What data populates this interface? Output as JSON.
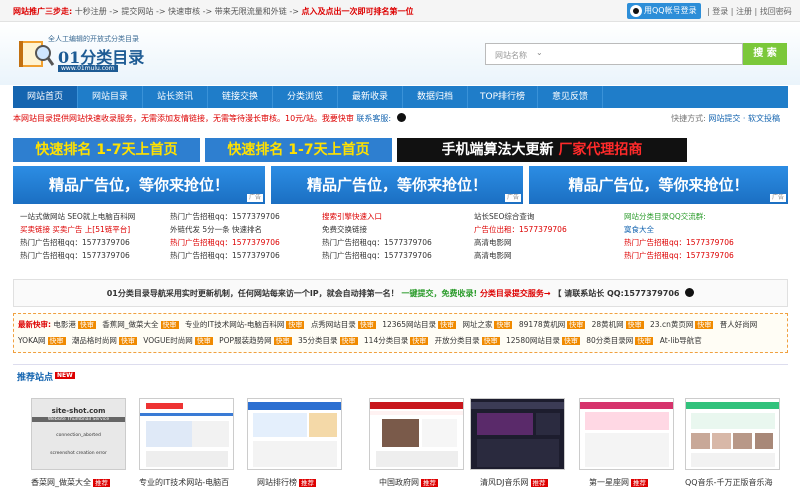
{
  "topbar": {
    "lead": "网站推广三步走:",
    "steps": "十秒注册 -> 提交网站 -> 快速审核 -> 带来无限流量和外链 ->",
    "highlight": "点入及点出一次即可排名第一位",
    "qq_login": "用QQ帐号登录",
    "links": "| 登录 | 注册 | 找回密码"
  },
  "header": {
    "logo_tagline": "全人工编辑的开放式分类目录",
    "logo_name": "01分类目录",
    "logo_url": "www.01mulu.com",
    "search_placeholder": "网站名称",
    "search_button": "搜 索"
  },
  "nav": [
    "网站首页",
    "网站目录",
    "站长资讯",
    "链接交换",
    "分类浏览",
    "最新收录",
    "数据归档",
    "TOP排行榜",
    "意见反馈"
  ],
  "notice": {
    "text": "本网站目录提供网站快速收录服务，无需添加友情链接，无需等待漫长审核。10元/站。我要快审",
    "contact": "联系客服:",
    "right_label": "快捷方式:",
    "right_links": "网站提交 · 软文投稿"
  },
  "banners": {
    "b1": "快速排名 1-7天上首页",
    "b2": "快速排名 1-7天上首页",
    "b3_a": "手机端算法大更新",
    "b3_b": "厂家代理招商"
  },
  "ads": {
    "text": "精品广告位，等你来抢位！",
    "tag": "广告"
  },
  "links": {
    "col1": [
      "一站式做网站 SEO就上电脑百科网",
      "买卖链接 买卖广告 上[51链平台]",
      "热门广告招租qq：1577379706",
      "热门广告招租qq：1577379706"
    ],
    "col2": [
      "热门广告招租qq：1577379706",
      "外链代发 5分一条 快速排名",
      "热门广告招租qq：1577379706",
      "热门广告招租qq：1577379706"
    ],
    "col3": [
      "搜索引擎快速入口",
      "免费交换链接",
      "热门广告招租qq：1577379706",
      "热门广告招租qq：1577379706"
    ],
    "col4": [
      "站长SEO综合查询",
      "广告位出租：1577379706",
      "高清电影网",
      "高清电影网"
    ],
    "col5": [
      "网站分类目录QQ交流群:",
      "寞食大全",
      "热门广告招租qq：1577379706",
      "热门广告招租qq：1577379706"
    ]
  },
  "strip": {
    "text": "01分类目录导航采用实时更新机制，任何网站每来访一个IP，就会自动排第一名！",
    "green": "一键提交，免费收录!",
    "red": "分类目录提交服务→",
    "contact": "【 请联系站长 QQ:1577379706"
  },
  "latest": {
    "label": "最新快审:",
    "items": [
      "电影港",
      "香蕉网_做菜大全",
      "专业的IT技术网站-电脑百科网",
      "点秀网站目录",
      "12365网站目录",
      "网址之家",
      "89178黄机网",
      "28黄机网",
      "23.cn黄页网",
      "晋人好尚网",
      "YOKA网",
      "潮品格时尚网",
      "VOGUE时尚网",
      "POP服装趋势网",
      "35分类目录",
      "114分类目录",
      "开放分类目录",
      "12580网站目录",
      "80分类目录网",
      "At-lib导航官"
    ],
    "tag": "快审"
  },
  "recommend": {
    "title": "推荐站点",
    "badge": "NEW",
    "sites": [
      {
        "name": "香菜网_做菜大全",
        "shot_title": "site-shot.com",
        "shot_sub": "Website Thumbnail Service",
        "shot_err1": "connection_aborted",
        "shot_err2": "screenshot creation error"
      },
      {
        "name": "专业的IT技术网站-电脑百"
      },
      {
        "name": "网站排行榜"
      },
      {
        "name": "中国政府网"
      },
      {
        "name": "清风DJ音乐网"
      },
      {
        "name": "第一星座网"
      },
      {
        "name": "QQ音乐-千万正版音乐海"
      }
    ],
    "tag": "推荐"
  }
}
